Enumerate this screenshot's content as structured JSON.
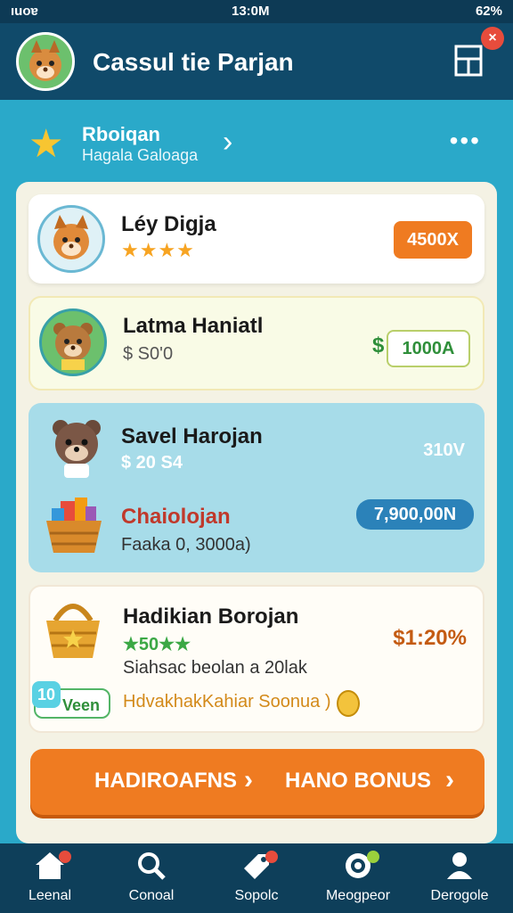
{
  "status": {
    "left": "ıuoɐ",
    "time": "13:0M",
    "right": "62%"
  },
  "header": {
    "title": "Cassul tie Parjan",
    "close_badge": "×"
  },
  "subheader": {
    "title": "Rboiqan",
    "subtitle": "Hagala Galoaga",
    "chevron": "›",
    "more": "•••"
  },
  "cards": [
    {
      "name": "Léy Digja",
      "stars": "★★★★",
      "price": "4500X"
    },
    {
      "name": "Latma Haniatl",
      "sub": "$ S0'0",
      "price_symbol": "$",
      "price": "1000A"
    },
    {
      "name": "Savel Harojan",
      "sub": "$  20 S4",
      "side": "310V",
      "item": "Chaiolojan",
      "item_sub": "Faaka 0, 3000a)",
      "pill": "7,900,00N"
    },
    {
      "name": "Hadikian Borojan",
      "stars": "★50★★",
      "pct": "$1:20%",
      "line": "Siahsac beolan a 20lak",
      "badge": "Veen",
      "badge_icon": "10",
      "bonus": "HdvakhakKahiar Soonua )"
    }
  ],
  "cta": {
    "left": "HADIROAFNS",
    "right": "HANO BONUS",
    "chevron": "›"
  },
  "nav": [
    {
      "label": "Leenal",
      "icon": "home-icon"
    },
    {
      "label": "Conoal",
      "icon": "search-icon"
    },
    {
      "label": "Sopolc",
      "icon": "tag-icon"
    },
    {
      "label": "Meogpeor",
      "icon": "target-icon"
    },
    {
      "label": "Derogole",
      "icon": "user-icon"
    }
  ]
}
